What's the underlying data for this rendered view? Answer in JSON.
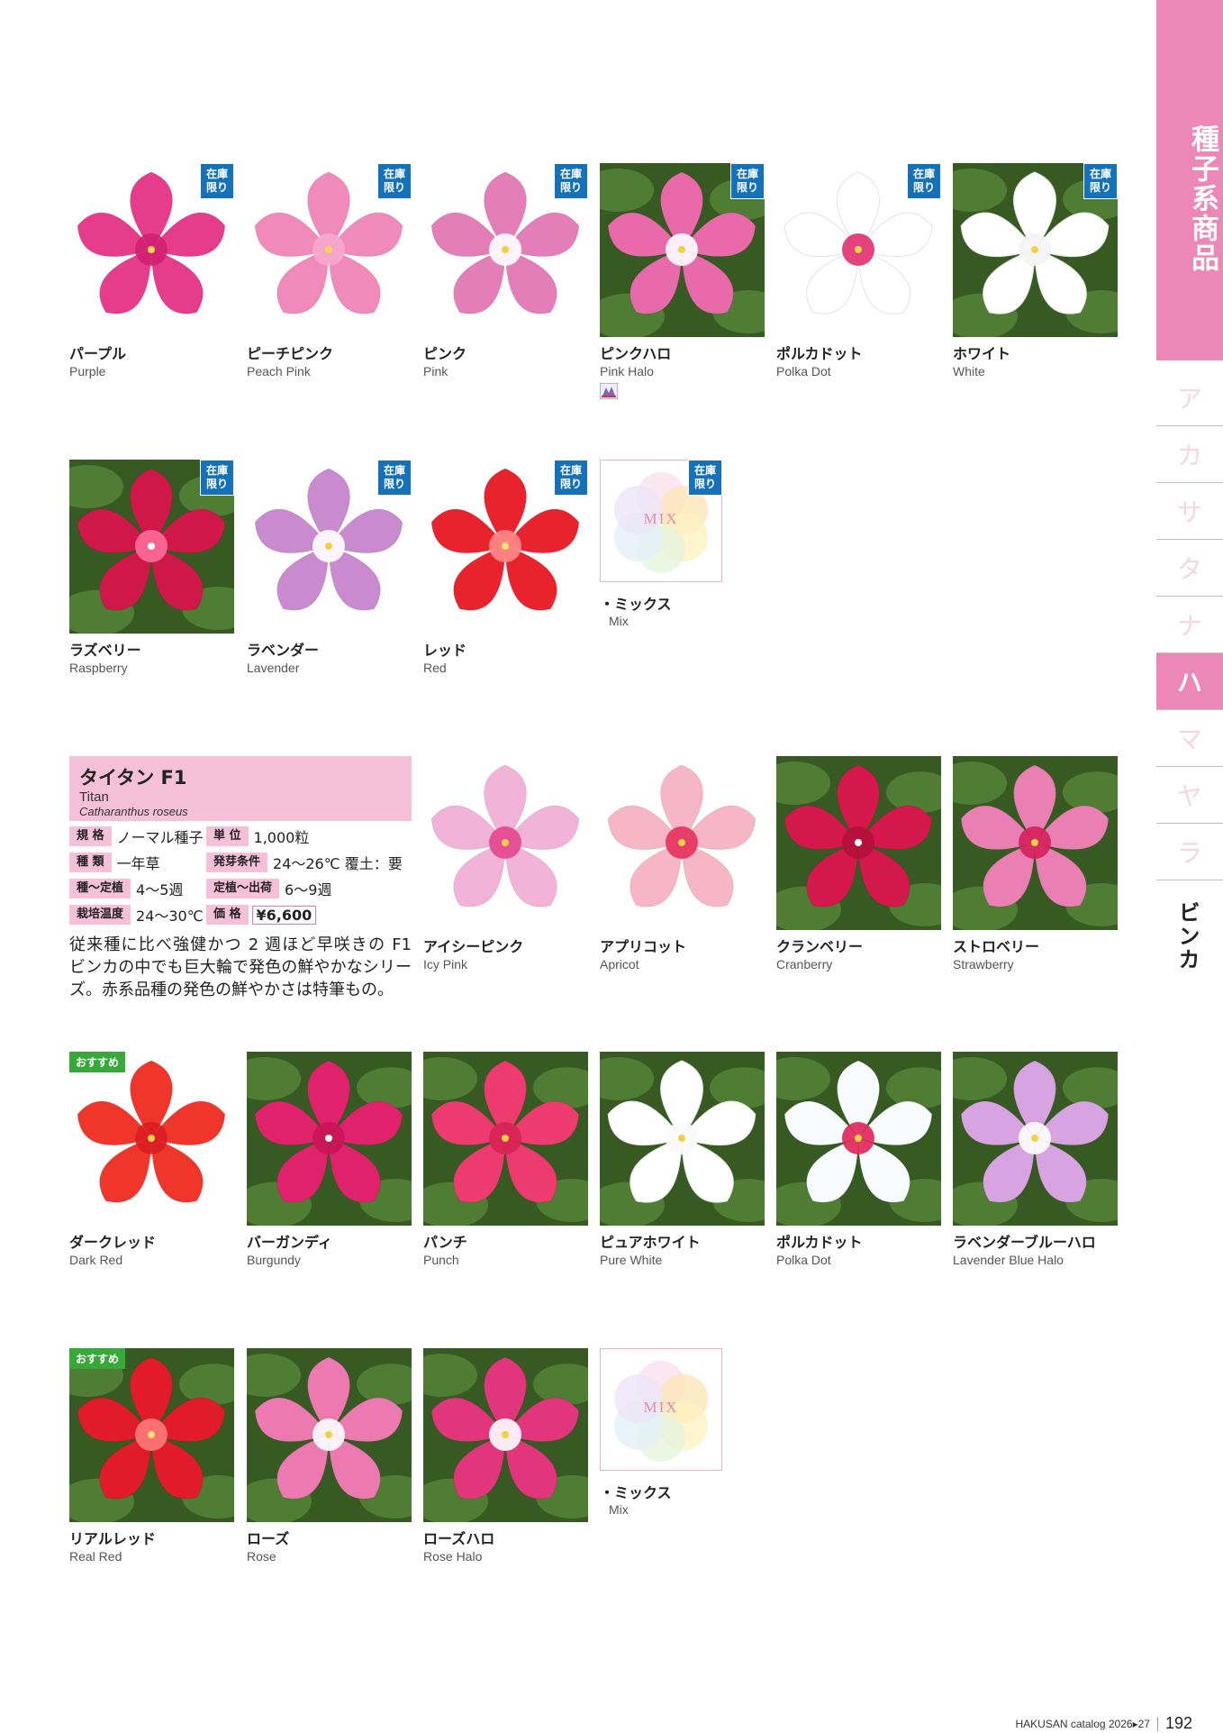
{
  "sidebar": {
    "category": "種子系商品",
    "kana": [
      "ア",
      "カ",
      "サ",
      "タ",
      "ナ",
      "ハ",
      "マ",
      "ヤ",
      "ラ"
    ],
    "active_index": 5,
    "current_category": "ビンカ"
  },
  "badges": {
    "stock": "在庫\n限り",
    "recommend": "おすすめ"
  },
  "row1": [
    {
      "ja": "パープル",
      "en": "Purple",
      "petal": "#e63c8c",
      "center": "#d11f6f",
      "eye": "#f8d35c",
      "bg": "white",
      "award": false
    },
    {
      "ja": "ピーチピンク",
      "en": "Peach Pink",
      "petal": "#f08abb",
      "center": "#f6a9cc",
      "eye": "#f8d35c",
      "bg": "white",
      "award": false
    },
    {
      "ja": "ピンク",
      "en": "Pink",
      "petal": "#e37eb9",
      "center": "#ffffff",
      "eye": "#f2d046",
      "bg": "white",
      "award": false
    },
    {
      "ja": "ピンクハロ",
      "en": "Pink Halo",
      "petal": "#e86aaa",
      "center": "#ffffff",
      "eye": "#f2d046",
      "bg": "dark",
      "award": true
    },
    {
      "ja": "ポルカドット",
      "en": "Polka Dot",
      "petal": "#ffffff",
      "center": "#e03070",
      "eye": "#f2d046",
      "bg": "white",
      "award": false
    },
    {
      "ja": "ホワイト",
      "en": "White",
      "petal": "#ffffff",
      "center": "#f4f4f4",
      "eye": "#f2d046",
      "bg": "dark",
      "award": false
    }
  ],
  "row2": [
    {
      "ja": "ラズベリー",
      "en": "Raspberry",
      "petal": "#d01848",
      "center": "#ff6d9a",
      "eye": "#ffffff",
      "bg": "dark"
    },
    {
      "ja": "ラベンダー",
      "en": "Lavender",
      "petal": "#c98ad0",
      "center": "#ffffff",
      "eye": "#f2d046",
      "bg": "white"
    },
    {
      "ja": "レッド",
      "en": "Red",
      "petal": "#e8232d",
      "center": "#ff8a8a",
      "eye": "#f8e36c",
      "bg": "white"
    }
  ],
  "mix": {
    "word": "MIX",
    "ja": "・ミックス",
    "en": "Mix"
  },
  "series": {
    "title": "タイタン F1",
    "en": "Titan",
    "latin": "Catharanthus roseus",
    "specs": {
      "spec_label": "規 格",
      "spec_value": "ノーマル種子",
      "unit_label": "単 位",
      "unit_value": "1,000粒",
      "type_label": "種 類",
      "type_value": "一年草",
      "germ_label": "発芽条件",
      "germ_value": "24〜26℃ 覆土：要",
      "plant_label": "種〜定植",
      "plant_value": "4〜5週",
      "ship_label": "定植〜出荷",
      "ship_value": "6〜9週",
      "temp_label": "栽培温度",
      "temp_value": "24〜30℃",
      "price_label": "価 格",
      "price_value": "¥6,600"
    },
    "description": "従来種に比べ強健かつ 2 週ほど早咲きの F1 ビンカの中でも巨大輪で発色の鮮やかなシリーズ。赤系品種の発色の鮮やかさは特筆もの。"
  },
  "row3": [
    {
      "ja": "アイシーピンク",
      "en": "Icy Pink",
      "petal": "#f2b3d8",
      "center": "#e4468f",
      "eye": "#f2d046",
      "bg": "white"
    },
    {
      "ja": "アプリコット",
      "en": "Apricot",
      "petal": "#f7b6c6",
      "center": "#e4315c",
      "eye": "#f2d046",
      "bg": "white"
    },
    {
      "ja": "クランベリー",
      "en": "Cranberry",
      "petal": "#d4184b",
      "center": "#b20f3a",
      "eye": "#ffffff",
      "bg": "dark"
    },
    {
      "ja": "ストロベリー",
      "en": "Strawberry",
      "petal": "#e97fb2",
      "center": "#d5205a",
      "eye": "#f2d046",
      "bg": "dark"
    }
  ],
  "row4": [
    {
      "ja": "ダークレッド",
      "en": "Dark Red",
      "petal": "#f0352b",
      "center": "#d81d22",
      "eye": "#ffd04c",
      "bg": "white",
      "recommend": true
    },
    {
      "ja": "バーガンディ",
      "en": "Burgundy",
      "petal": "#e0226c",
      "center": "#c81558",
      "eye": "#ffffff",
      "bg": "dark",
      "recommend": false
    },
    {
      "ja": "パンチ",
      "en": "Punch",
      "petal": "#ee3b6f",
      "center": "#d82353",
      "eye": "#f2d046",
      "bg": "dark",
      "recommend": false
    },
    {
      "ja": "ピュアホワイト",
      "en": "Pure White",
      "petal": "#ffffff",
      "center": "#fbfbfb",
      "eye": "#f2d046",
      "bg": "dark",
      "recommend": false
    },
    {
      "ja": "ポルカドット",
      "en": "Polka Dot",
      "petal": "#f8fbff",
      "center": "#e02458",
      "eye": "#f2d046",
      "bg": "dark",
      "recommend": false
    },
    {
      "ja": "ラベンダーブルーハロ",
      "en": "Lavender Blue Halo",
      "petal": "#d7a3e0",
      "center": "#ffffff",
      "eye": "#f2d046",
      "bg": "dark",
      "recommend": false
    }
  ],
  "row5": [
    {
      "ja": "リアルレッド",
      "en": "Real Red",
      "petal": "#e21b2a",
      "center": "#ff7a7a",
      "eye": "#ffe07a",
      "bg": "dark",
      "recommend": true
    },
    {
      "ja": "ローズ",
      "en": "Rose",
      "petal": "#ec79b0",
      "center": "#ffffff",
      "eye": "#f2d046",
      "bg": "dark",
      "recommend": false
    },
    {
      "ja": "ローズハロ",
      "en": "Rose Halo",
      "petal": "#e1367c",
      "center": "#ffffff",
      "eye": "#f2d046",
      "bg": "dark",
      "recommend": false
    }
  ],
  "footer": {
    "catalog": "HAKUSAN catalog 2026▸27",
    "page": "192"
  }
}
